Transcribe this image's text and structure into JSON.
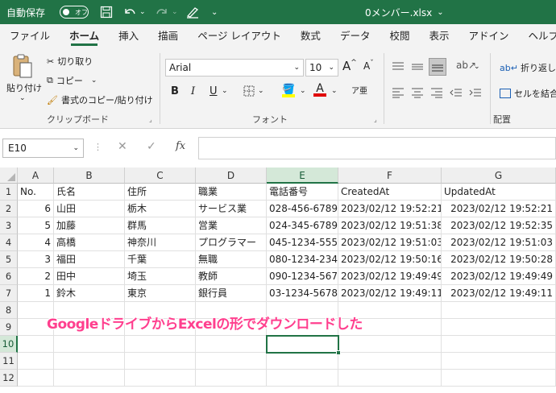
{
  "titlebar": {
    "autosave_label": "自動保存",
    "toggle_state": "オフ",
    "filename": "0メンバー.xlsx"
  },
  "menu": [
    "ファイル",
    "ホーム",
    "挿入",
    "描画",
    "ページ レイアウト",
    "数式",
    "データ",
    "校閲",
    "表示",
    "アドイン",
    "ヘルプ"
  ],
  "ribbon": {
    "paste": "貼り付け",
    "cut": "切り取り",
    "copy": "コピー",
    "format_painter": "書式のコピー/貼り付け",
    "clipboard_group": "クリップボード",
    "font_name": "Arial",
    "font_size": "10",
    "font_group": "フォント",
    "bold": "B",
    "italic": "I",
    "underline": "U",
    "grow": "A",
    "shrink": "A",
    "font_color": "A",
    "wrap_text": "折り返して",
    "merge": "セルを結合",
    "align_group": "配置"
  },
  "formula_bar": {
    "name_box": "E10",
    "fx": "fx",
    "value": ""
  },
  "columns": [
    "A",
    "B",
    "C",
    "D",
    "E",
    "F",
    "G"
  ],
  "rows": [
    "1",
    "2",
    "3",
    "4",
    "5",
    "6",
    "7",
    "8",
    "9",
    "10",
    "11",
    "12"
  ],
  "table": [
    [
      "No.",
      "氏名",
      "住所",
      "職業",
      "電話番号",
      "CreatedAt",
      "UpdatedAt"
    ],
    [
      "6",
      "山田",
      "栃木",
      "サービス業",
      "028-456-6789",
      "2023/02/12 19:52:21",
      "2023/02/12 19:52:21"
    ],
    [
      "5",
      "加藤",
      "群馬",
      "営業",
      "024-345-6789",
      "2023/02/12 19:51:38",
      "2023/02/12 19:52:35"
    ],
    [
      "4",
      "高橋",
      "神奈川",
      "プログラマー",
      "045-1234-5555",
      "2023/02/12 19:51:03",
      "2023/02/12 19:51:03"
    ],
    [
      "3",
      "福田",
      "千葉",
      "無職",
      "080-1234-2345",
      "2023/02/12 19:50:16",
      "2023/02/12 19:50:28"
    ],
    [
      "2",
      "田中",
      "埼玉",
      "教師",
      "090-1234-5678",
      "2023/02/12 19:49:49",
      "2023/02/12 19:49:49"
    ],
    [
      "1",
      "鈴木",
      "東京",
      "銀行員",
      "03-1234-5678",
      "2023/02/12 19:49:11",
      "2023/02/12 19:49:11"
    ]
  ],
  "overlay_text": "GoogleドライブからExcelの形でダウンロードした",
  "colors": {
    "accent": "#217346",
    "overlay": "#ff3f8e"
  }
}
